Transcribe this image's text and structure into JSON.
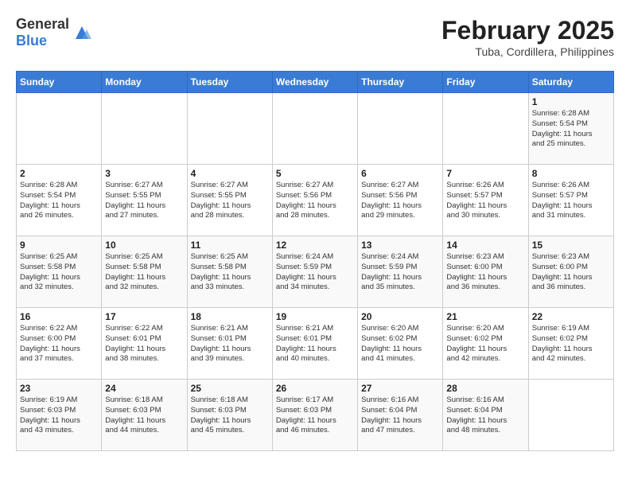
{
  "header": {
    "logo_general": "General",
    "logo_blue": "Blue",
    "month_year": "February 2025",
    "location": "Tuba, Cordillera, Philippines"
  },
  "days_of_week": [
    "Sunday",
    "Monday",
    "Tuesday",
    "Wednesday",
    "Thursday",
    "Friday",
    "Saturday"
  ],
  "weeks": [
    [
      {
        "day": "",
        "info": ""
      },
      {
        "day": "",
        "info": ""
      },
      {
        "day": "",
        "info": ""
      },
      {
        "day": "",
        "info": ""
      },
      {
        "day": "",
        "info": ""
      },
      {
        "day": "",
        "info": ""
      },
      {
        "day": "1",
        "info": "Sunrise: 6:28 AM\nSunset: 5:54 PM\nDaylight: 11 hours\nand 25 minutes."
      }
    ],
    [
      {
        "day": "2",
        "info": "Sunrise: 6:28 AM\nSunset: 5:54 PM\nDaylight: 11 hours\nand 26 minutes."
      },
      {
        "day": "3",
        "info": "Sunrise: 6:27 AM\nSunset: 5:55 PM\nDaylight: 11 hours\nand 27 minutes."
      },
      {
        "day": "4",
        "info": "Sunrise: 6:27 AM\nSunset: 5:55 PM\nDaylight: 11 hours\nand 28 minutes."
      },
      {
        "day": "5",
        "info": "Sunrise: 6:27 AM\nSunset: 5:56 PM\nDaylight: 11 hours\nand 28 minutes."
      },
      {
        "day": "6",
        "info": "Sunrise: 6:27 AM\nSunset: 5:56 PM\nDaylight: 11 hours\nand 29 minutes."
      },
      {
        "day": "7",
        "info": "Sunrise: 6:26 AM\nSunset: 5:57 PM\nDaylight: 11 hours\nand 30 minutes."
      },
      {
        "day": "8",
        "info": "Sunrise: 6:26 AM\nSunset: 5:57 PM\nDaylight: 11 hours\nand 31 minutes."
      }
    ],
    [
      {
        "day": "9",
        "info": "Sunrise: 6:25 AM\nSunset: 5:58 PM\nDaylight: 11 hours\nand 32 minutes."
      },
      {
        "day": "10",
        "info": "Sunrise: 6:25 AM\nSunset: 5:58 PM\nDaylight: 11 hours\nand 32 minutes."
      },
      {
        "day": "11",
        "info": "Sunrise: 6:25 AM\nSunset: 5:58 PM\nDaylight: 11 hours\nand 33 minutes."
      },
      {
        "day": "12",
        "info": "Sunrise: 6:24 AM\nSunset: 5:59 PM\nDaylight: 11 hours\nand 34 minutes."
      },
      {
        "day": "13",
        "info": "Sunrise: 6:24 AM\nSunset: 5:59 PM\nDaylight: 11 hours\nand 35 minutes."
      },
      {
        "day": "14",
        "info": "Sunrise: 6:23 AM\nSunset: 6:00 PM\nDaylight: 11 hours\nand 36 minutes."
      },
      {
        "day": "15",
        "info": "Sunrise: 6:23 AM\nSunset: 6:00 PM\nDaylight: 11 hours\nand 36 minutes."
      }
    ],
    [
      {
        "day": "16",
        "info": "Sunrise: 6:22 AM\nSunset: 6:00 PM\nDaylight: 11 hours\nand 37 minutes."
      },
      {
        "day": "17",
        "info": "Sunrise: 6:22 AM\nSunset: 6:01 PM\nDaylight: 11 hours\nand 38 minutes."
      },
      {
        "day": "18",
        "info": "Sunrise: 6:21 AM\nSunset: 6:01 PM\nDaylight: 11 hours\nand 39 minutes."
      },
      {
        "day": "19",
        "info": "Sunrise: 6:21 AM\nSunset: 6:01 PM\nDaylight: 11 hours\nand 40 minutes."
      },
      {
        "day": "20",
        "info": "Sunrise: 6:20 AM\nSunset: 6:02 PM\nDaylight: 11 hours\nand 41 minutes."
      },
      {
        "day": "21",
        "info": "Sunrise: 6:20 AM\nSunset: 6:02 PM\nDaylight: 11 hours\nand 42 minutes."
      },
      {
        "day": "22",
        "info": "Sunrise: 6:19 AM\nSunset: 6:02 PM\nDaylight: 11 hours\nand 42 minutes."
      }
    ],
    [
      {
        "day": "23",
        "info": "Sunrise: 6:19 AM\nSunset: 6:03 PM\nDaylight: 11 hours\nand 43 minutes."
      },
      {
        "day": "24",
        "info": "Sunrise: 6:18 AM\nSunset: 6:03 PM\nDaylight: 11 hours\nand 44 minutes."
      },
      {
        "day": "25",
        "info": "Sunrise: 6:18 AM\nSunset: 6:03 PM\nDaylight: 11 hours\nand 45 minutes."
      },
      {
        "day": "26",
        "info": "Sunrise: 6:17 AM\nSunset: 6:03 PM\nDaylight: 11 hours\nand 46 minutes."
      },
      {
        "day": "27",
        "info": "Sunrise: 6:16 AM\nSunset: 6:04 PM\nDaylight: 11 hours\nand 47 minutes."
      },
      {
        "day": "28",
        "info": "Sunrise: 6:16 AM\nSunset: 6:04 PM\nDaylight: 11 hours\nand 48 minutes."
      },
      {
        "day": "",
        "info": ""
      }
    ]
  ]
}
